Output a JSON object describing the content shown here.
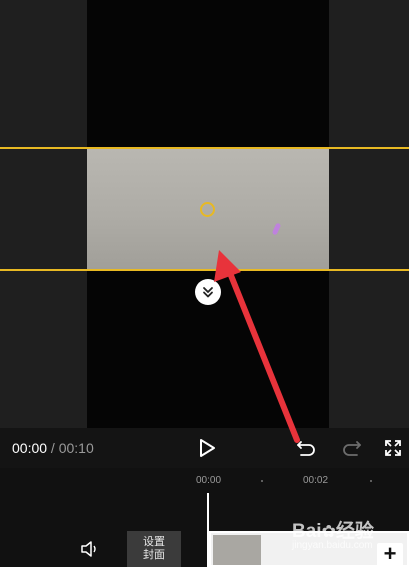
{
  "player": {
    "time_current": "00:00",
    "time_separator": " / ",
    "time_total": "00:10"
  },
  "controls": {
    "play_icon": "play-icon",
    "undo_icon": "undo-icon",
    "redo_icon": "redo-icon",
    "fullscreen_icon": "fullscreen-icon",
    "collapse_icon": "double-chevron-down-icon"
  },
  "timeline": {
    "ruler_labels": [
      "00:00",
      "00:02"
    ],
    "mute_icon": "speaker-icon",
    "cover_button_line1": "设置",
    "cover_button_line2": "封面",
    "add_clip_label": "+"
  },
  "watermark": {
    "logo_text": "Bai",
    "logo_suffix": "经验",
    "site": "jingyan.baidu.com"
  },
  "colors": {
    "crop_accent": "#e8b923",
    "annotation_arrow": "#e8333b",
    "background": "#1b1b1b"
  }
}
